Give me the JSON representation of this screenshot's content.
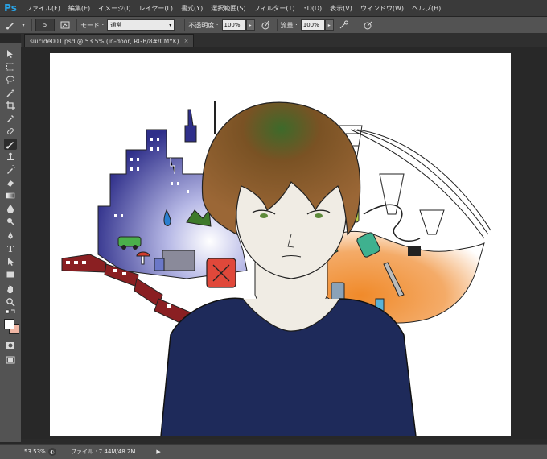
{
  "app": {
    "logo": "Ps"
  },
  "menu": [
    "ファイル(F)",
    "編集(E)",
    "イメージ(I)",
    "レイヤー(L)",
    "書式(Y)",
    "選択範囲(S)",
    "フィルター(T)",
    "3D(D)",
    "表示(V)",
    "ウィンドウ(W)",
    "ヘルプ(H)"
  ],
  "options": {
    "brush_size": "5",
    "mode_label": "モード :",
    "mode_value": "通常",
    "opacity_label": "不透明度 :",
    "opacity_value": "100%",
    "flow_label": "流量 :",
    "flow_value": "100%"
  },
  "document": {
    "tab_title": "suicide001.psd @ 53.5% (in-door, RGB/8#/CMYK)",
    "close": "×"
  },
  "status": {
    "zoom": "53.53%",
    "file_info": "ファイル : 7.44M/48.2M"
  },
  "colors": {
    "accent": "#29a3e6",
    "foreground": "#ffffff",
    "background": "#f0b6a4"
  }
}
